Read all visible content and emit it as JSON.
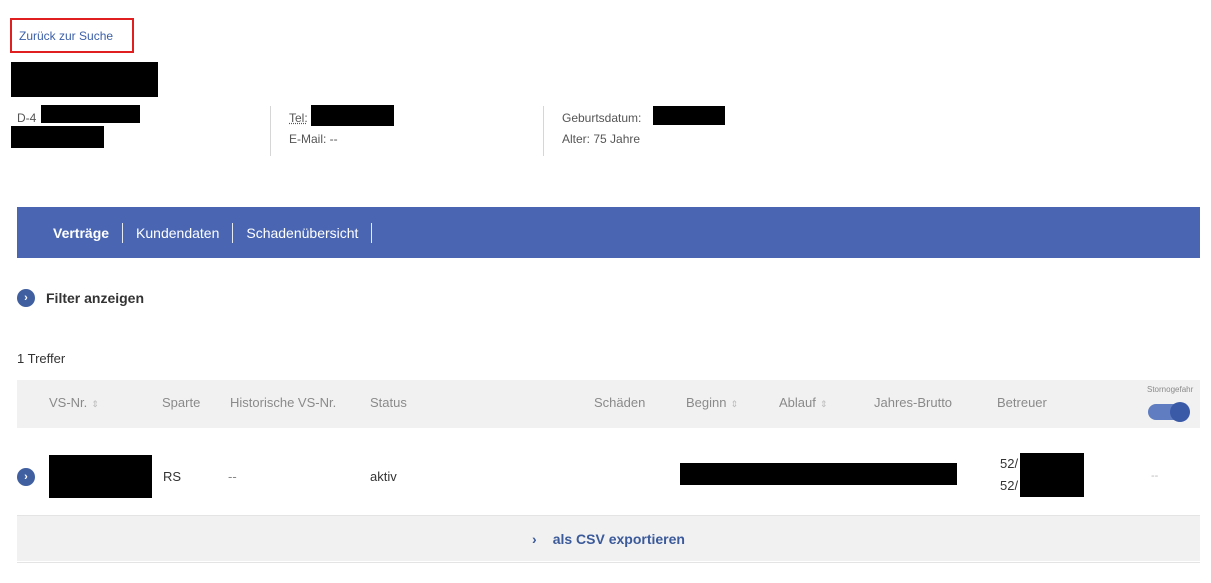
{
  "header": {
    "back_link": "Zurück zur Suche",
    "address_prefix": "D-4",
    "tel_label": "Tel:",
    "email_text": "E-Mail: --",
    "birthdate_label": "Geburtsdatum:",
    "age_text": "Alter: 75 Jahre"
  },
  "tabs": [
    {
      "label": "Verträge",
      "active": true
    },
    {
      "label": "Kundendaten",
      "active": false
    },
    {
      "label": "Schadenübersicht",
      "active": false
    }
  ],
  "filter": {
    "label": "Filter anzeigen"
  },
  "results": {
    "count_text": "1 Treffer"
  },
  "table": {
    "headers": {
      "vs_nr": "VS-Nr.",
      "sparte": "Sparte",
      "hist_vs_nr": "Historische VS-Nr.",
      "status": "Status",
      "schaeden": "Schäden",
      "beginn": "Beginn",
      "ablauf": "Ablauf",
      "jahres_brutto": "Jahres-Brutto",
      "betreuer": "Betreuer",
      "stornogefahr": "Stornogefahr"
    },
    "sort_icon": "⇕",
    "stornogefahr_toggle_on": true,
    "rows": [
      {
        "sparte": "RS",
        "hist_vs_nr": "--",
        "status": "aktiv",
        "betreuer_line1": "52/",
        "betreuer_line2": "52/",
        "stornogefahr": "--"
      }
    ]
  },
  "export": {
    "label": "als CSV exportieren",
    "icon": "chevron-right"
  },
  "colors": {
    "tabbar": "#4a66b2",
    "highlight_border": "#e02020",
    "accent": "#3f5fa0"
  }
}
